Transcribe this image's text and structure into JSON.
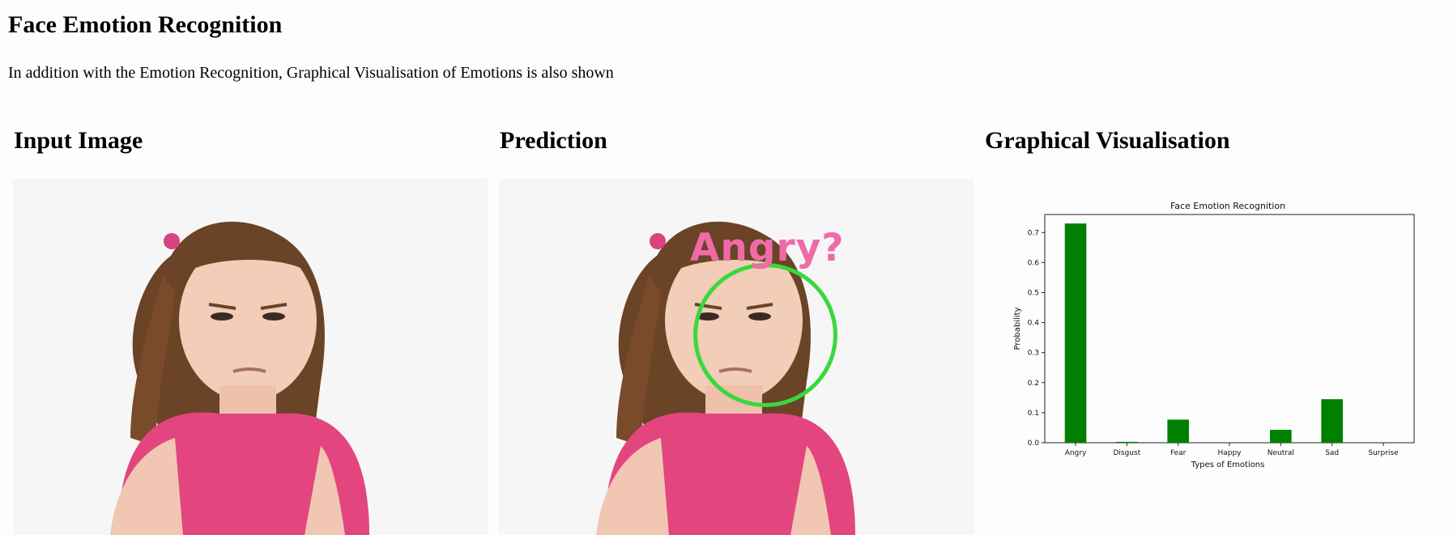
{
  "page": {
    "title": "Face Emotion Recognition",
    "subtitle": "In addition with the Emotion Recognition, Graphical Visualisation of Emotions is also shown"
  },
  "sections": {
    "input": "Input Image",
    "prediction": "Prediction",
    "visualisation": "Graphical Visualisation"
  },
  "prediction": {
    "label": "Angry?",
    "label_color": "#f06aa8",
    "circle_color": "#39d83f"
  },
  "chart_data": {
    "type": "bar",
    "title": "Face Emotion Recognition",
    "xlabel": "Types of Emotions",
    "ylabel": "Probability",
    "categories": [
      "Angry",
      "Disgust",
      "Fear",
      "Happy",
      "Neutral",
      "Sad",
      "Surprise"
    ],
    "values": [
      0.73,
      0.003,
      0.077,
      0.0,
      0.043,
      0.145,
      0.0
    ],
    "ylim": [
      0,
      0.76
    ],
    "yticks": [
      "0.0",
      "0.1",
      "0.2",
      "0.3",
      "0.4",
      "0.5",
      "0.6",
      "0.7"
    ],
    "bar_color": "#008000",
    "grid": false
  }
}
